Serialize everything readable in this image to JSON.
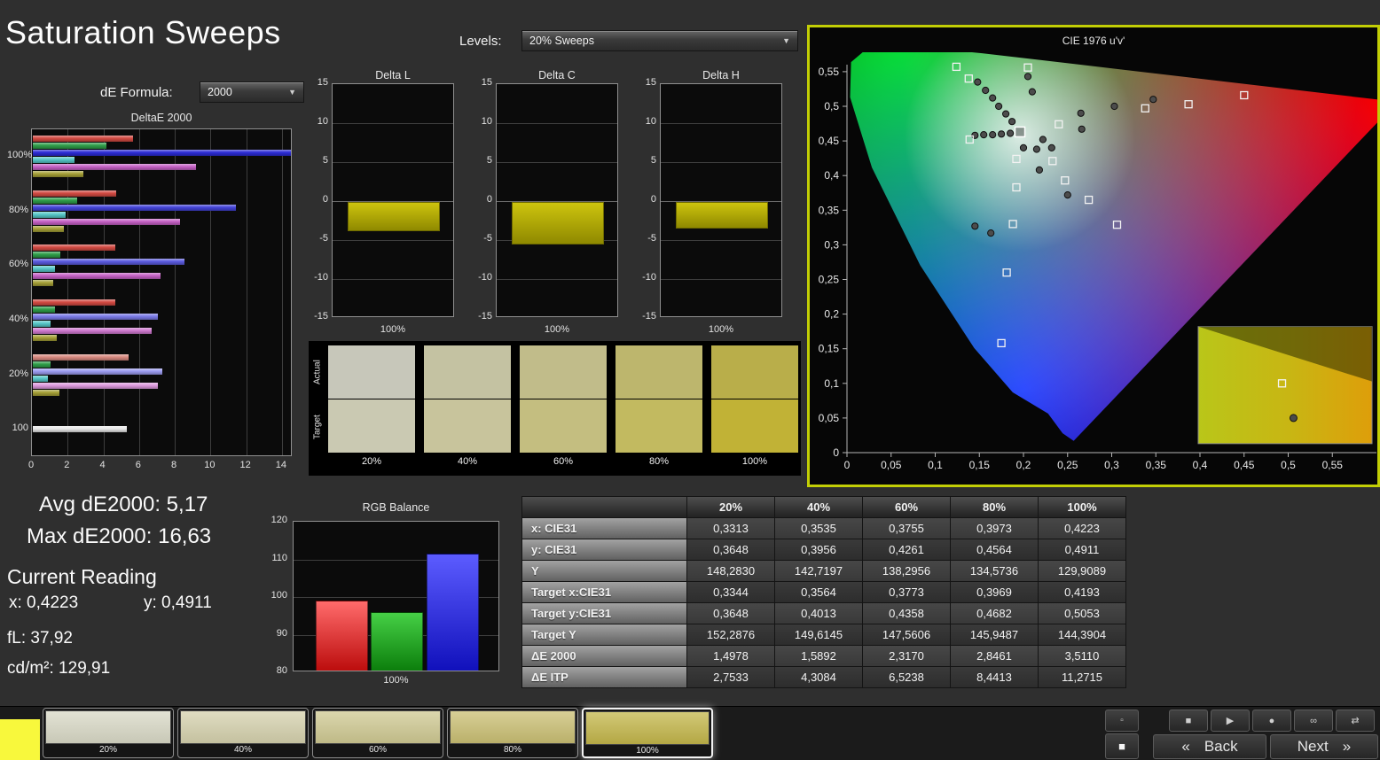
{
  "page": {
    "title": "Saturation Sweeps",
    "background": "#2f2f2f",
    "accent_border": "#c2ce05"
  },
  "icons": {
    "dropdown_arrow": "▼",
    "pattern_top": "▫",
    "pattern_main": "■"
  },
  "controls": {
    "de_formula_label": "dE Formula:",
    "de_formula_value": "2000",
    "levels_label": "Levels:",
    "levels_value": "20% Sweeps"
  },
  "stats": {
    "avg": "Avg dE2000: 5,17",
    "max": "Max dE2000: 16,63",
    "current_heading": "Current Reading",
    "x": "x: 0,4223",
    "y": "y: 0,4911",
    "fl": "fL: 37,92",
    "cdm2": "cd/m²: 129,91"
  },
  "chart_data": [
    {
      "name": "deltae_2000",
      "type": "bar",
      "orientation": "horizontal",
      "title": "DeltaE 2000",
      "xticks": [
        0,
        2,
        4,
        6,
        8,
        10,
        12,
        14
      ],
      "xlim": [
        0,
        14.6
      ],
      "groups": [
        {
          "label": "100%",
          "bars": [
            {
              "color": "#d24a42",
              "value": 5.6
            },
            {
              "color": "#2f9e49",
              "value": 4.1
            },
            {
              "color": "#2b2bd6",
              "value": 14.6
            },
            {
              "color": "#57c8c8",
              "value": 2.35
            },
            {
              "color": "#c661c6",
              "value": 9.15
            },
            {
              "color": "#a5a036",
              "value": 2.85
            }
          ]
        },
        {
          "label": "80%",
          "bars": [
            {
              "color": "#d24a42",
              "value": 4.65
            },
            {
              "color": "#2f9e49",
              "value": 2.5
            },
            {
              "color": "#4343d8",
              "value": 11.35
            },
            {
              "color": "#57c8c8",
              "value": 1.85
            },
            {
              "color": "#c661c6",
              "value": 8.25
            },
            {
              "color": "#a5a036",
              "value": 1.75
            }
          ]
        },
        {
          "label": "60%",
          "bars": [
            {
              "color": "#d24a42",
              "value": 4.6
            },
            {
              "color": "#2f9e49",
              "value": 1.55
            },
            {
              "color": "#5b5bdf",
              "value": 8.5
            },
            {
              "color": "#57c8c8",
              "value": 1.25
            },
            {
              "color": "#c661c6",
              "value": 7.15
            },
            {
              "color": "#a5a036",
              "value": 1.15
            }
          ]
        },
        {
          "label": "40%",
          "bars": [
            {
              "color": "#d24a42",
              "value": 4.6
            },
            {
              "color": "#2f9e49",
              "value": 1.25
            },
            {
              "color": "#7b7be8",
              "value": 7.0
            },
            {
              "color": "#57c8c8",
              "value": 1.0
            },
            {
              "color": "#d07ad0",
              "value": 6.65
            },
            {
              "color": "#a5a036",
              "value": 1.35
            }
          ]
        },
        {
          "label": "20%",
          "bars": [
            {
              "color": "#d98a80",
              "value": 5.35
            },
            {
              "color": "#2f9e49",
              "value": 1.0
            },
            {
              "color": "#9c9cf0",
              "value": 7.25
            },
            {
              "color": "#57c8c8",
              "value": 0.85
            },
            {
              "color": "#de9ade",
              "value": 7.0
            },
            {
              "color": "#a5a036",
              "value": 1.5
            }
          ]
        },
        {
          "label": "100",
          "bars": [
            {
              "color": "#e8e8e8",
              "value": 5.25
            }
          ]
        }
      ]
    },
    {
      "name": "delta_l",
      "type": "bar",
      "title": "Delta L",
      "categories": [
        "100%"
      ],
      "values": [
        -3.8
      ],
      "ylim": [
        -15,
        15
      ],
      "yticks": [
        15,
        10,
        5,
        0,
        -5,
        -10,
        -15
      ],
      "bar_color": "#b5ad00"
    },
    {
      "name": "delta_c",
      "type": "bar",
      "title": "Delta C",
      "categories": [
        "100%"
      ],
      "values": [
        -5.5
      ],
      "ylim": [
        -15,
        15
      ],
      "yticks": [
        15,
        10,
        5,
        0,
        -5,
        -10,
        -15
      ],
      "bar_color": "#b5ad00"
    },
    {
      "name": "delta_h",
      "type": "bar",
      "title": "Delta H",
      "categories": [
        "100%"
      ],
      "values": [
        -3.4
      ],
      "ylim": [
        -15,
        15
      ],
      "yticks": [
        15,
        10,
        5,
        0,
        -5,
        -10,
        -15
      ],
      "bar_color": "#b5ad00"
    },
    {
      "name": "rgb_balance",
      "type": "bar",
      "title": "RGB Balance",
      "categories": [
        "100%"
      ],
      "ylim": [
        80,
        120
      ],
      "yticks": [
        120,
        110,
        100,
        90,
        80
      ],
      "series": [
        {
          "name": "red",
          "values": [
            99
          ]
        },
        {
          "name": "green",
          "values": [
            96
          ]
        },
        {
          "name": "blue",
          "values": [
            111.5
          ]
        }
      ]
    },
    {
      "name": "cie_1976",
      "type": "scatter",
      "title": "CIE 1976 u'v'",
      "ticks": [
        "0",
        "0,05",
        "0,1",
        "0,15",
        "0,2",
        "0,25",
        "0,3",
        "0,35",
        "0,4",
        "0,45",
        "0,5",
        "0,55"
      ],
      "xlim": [
        0,
        0.6
      ],
      "ylim": [
        0,
        0.58
      ],
      "current_target": [
        0.196,
        0.463
      ],
      "targets": [
        [
          0.124,
          0.557
        ],
        [
          0.138,
          0.54
        ],
        [
          0.205,
          0.556
        ],
        [
          0.139,
          0.452
        ],
        [
          0.192,
          0.424
        ],
        [
          0.233,
          0.421
        ],
        [
          0.192,
          0.383
        ],
        [
          0.247,
          0.393
        ],
        [
          0.274,
          0.365
        ],
        [
          0.188,
          0.33
        ],
        [
          0.306,
          0.329
        ],
        [
          0.181,
          0.26
        ],
        [
          0.175,
          0.158
        ],
        [
          0.24,
          0.474
        ],
        [
          0.338,
          0.497
        ],
        [
          0.387,
          0.503
        ],
        [
          0.45,
          0.516
        ]
      ],
      "measurements": [
        [
          0.148,
          0.535
        ],
        [
          0.157,
          0.523
        ],
        [
          0.165,
          0.512
        ],
        [
          0.172,
          0.5
        ],
        [
          0.18,
          0.489
        ],
        [
          0.187,
          0.478
        ],
        [
          0.205,
          0.543
        ],
        [
          0.21,
          0.521
        ],
        [
          0.145,
          0.458
        ],
        [
          0.155,
          0.459
        ],
        [
          0.165,
          0.459
        ],
        [
          0.175,
          0.46
        ],
        [
          0.185,
          0.461
        ],
        [
          0.2,
          0.44
        ],
        [
          0.215,
          0.438
        ],
        [
          0.218,
          0.408
        ],
        [
          0.25,
          0.372
        ],
        [
          0.163,
          0.317
        ],
        [
          0.145,
          0.327
        ],
        [
          0.265,
          0.49
        ],
        [
          0.303,
          0.5
        ],
        [
          0.347,
          0.51
        ],
        [
          0.266,
          0.467
        ],
        [
          0.222,
          0.452
        ],
        [
          0.232,
          0.44
        ]
      ],
      "inset": {
        "rect": [
          0.398,
          0.013,
          0.595,
          0.182
        ],
        "square": [
          0.493,
          0.1
        ],
        "circle": [
          0.506,
          0.05
        ]
      }
    }
  ],
  "saturation_swatches": {
    "row_labels": [
      "Actual",
      "Target"
    ],
    "levels": [
      "20%",
      "40%",
      "60%",
      "80%",
      "100%"
    ],
    "actual_colors": [
      "#c7c7ba",
      "#c4c2a2",
      "#c1bc8a",
      "#bdb66d",
      "#b9ae4a"
    ],
    "target_colors": [
      "#cac9b2",
      "#c8c49c",
      "#c4be80",
      "#c2ba60",
      "#c1b236"
    ]
  },
  "measurement_table": {
    "columns": [
      "",
      "20%",
      "40%",
      "60%",
      "80%",
      "100%"
    ],
    "rows": [
      {
        "label": "x: CIE31",
        "values": [
          "0,3313",
          "0,3535",
          "0,3755",
          "0,3973",
          "0,4223"
        ]
      },
      {
        "label": "y: CIE31",
        "values": [
          "0,3648",
          "0,3956",
          "0,4261",
          "0,4564",
          "0,4911"
        ]
      },
      {
        "label": "Y",
        "values": [
          "148,2830",
          "142,7197",
          "138,2956",
          "134,5736",
          "129,9089"
        ]
      },
      {
        "label": "Target x:CIE31",
        "values": [
          "0,3344",
          "0,3564",
          "0,3773",
          "0,3969",
          "0,4193"
        ]
      },
      {
        "label": "Target y:CIE31",
        "values": [
          "0,3648",
          "0,4013",
          "0,4358",
          "0,4682",
          "0,5053"
        ]
      },
      {
        "label": "Target Y",
        "values": [
          "152,2876",
          "149,6145",
          "147,5606",
          "145,9487",
          "144,3904"
        ]
      },
      {
        "label": "ΔE 2000",
        "values": [
          "1,4978",
          "1,5892",
          "2,3170",
          "2,8461",
          "3,5110"
        ]
      },
      {
        "label": "ΔE ITP",
        "values": [
          "2,7533",
          "4,3084",
          "6,5238",
          "8,4413",
          "11,2715"
        ]
      }
    ]
  },
  "bottom_bar": {
    "corner_color": "#f8f83c",
    "patches": [
      {
        "label": "20%",
        "color": "#d9d9c6",
        "active": false
      },
      {
        "label": "40%",
        "color": "#d5d1ad",
        "active": false
      },
      {
        "label": "60%",
        "color": "#cfc992",
        "active": false
      },
      {
        "label": "80%",
        "color": "#cabf73",
        "active": false
      },
      {
        "label": "100%",
        "color": "#c3b64a",
        "active": true
      }
    ],
    "transport": [
      {
        "name": "stop-button",
        "glyph": "■"
      },
      {
        "name": "play-button",
        "glyph": "▶"
      },
      {
        "name": "record-button",
        "glyph": "●"
      },
      {
        "name": "loop-button",
        "glyph": "∞"
      },
      {
        "name": "shuffle-button",
        "glyph": "⇄"
      }
    ],
    "nav": {
      "back_arrow": "«",
      "back": "Back",
      "next": "Next",
      "next_arrow": "»"
    }
  }
}
